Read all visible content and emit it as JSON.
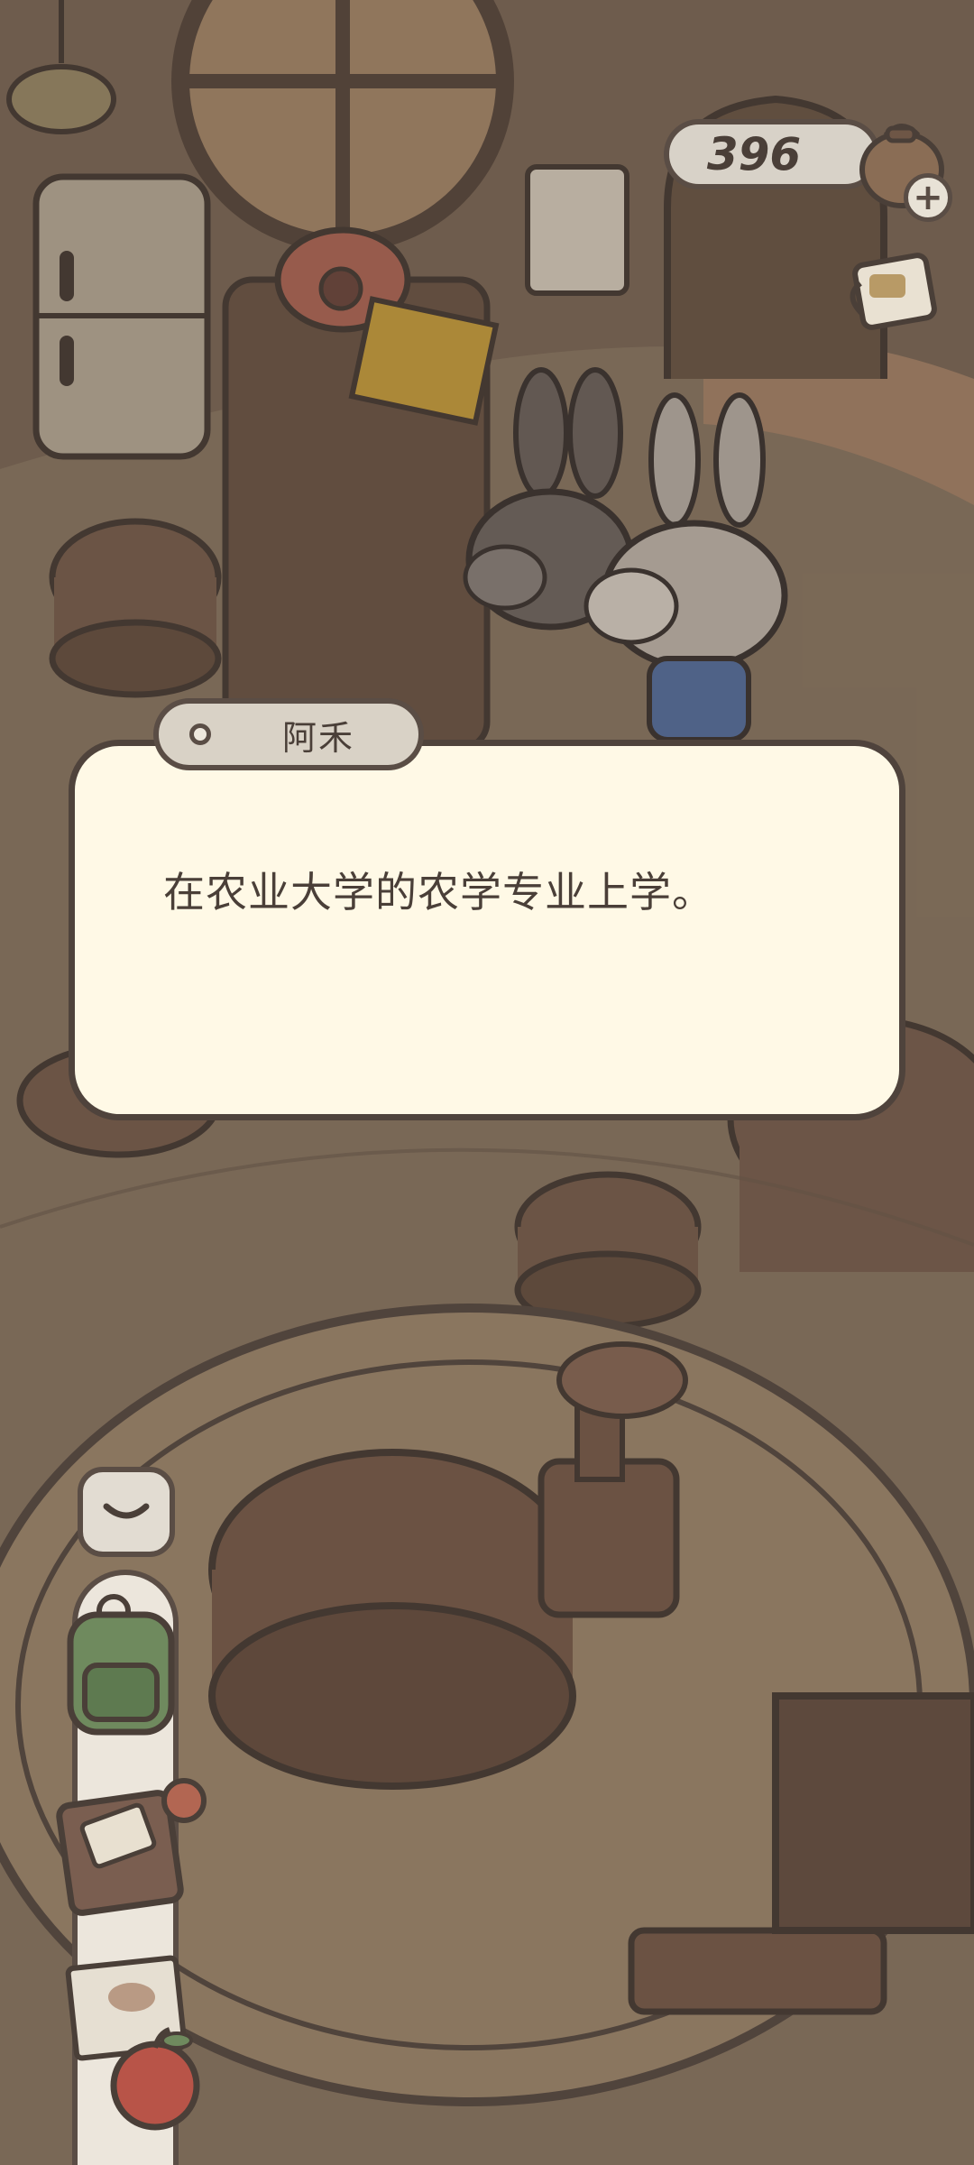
{
  "hud": {
    "coins": "396",
    "plus_label": "+",
    "coin_bag_icon": "coin-bag-icon",
    "cup_icon": "coffee-cup-icon"
  },
  "dialog": {
    "speaker": "阿禾",
    "text": "在农业大学的农学专业上学。"
  },
  "toolbar": {
    "collapse_icon": "chevron-down-icon",
    "items": [
      "backpack-icon",
      "journal-icon",
      "newspaper-icon",
      "apple-icon"
    ]
  }
}
